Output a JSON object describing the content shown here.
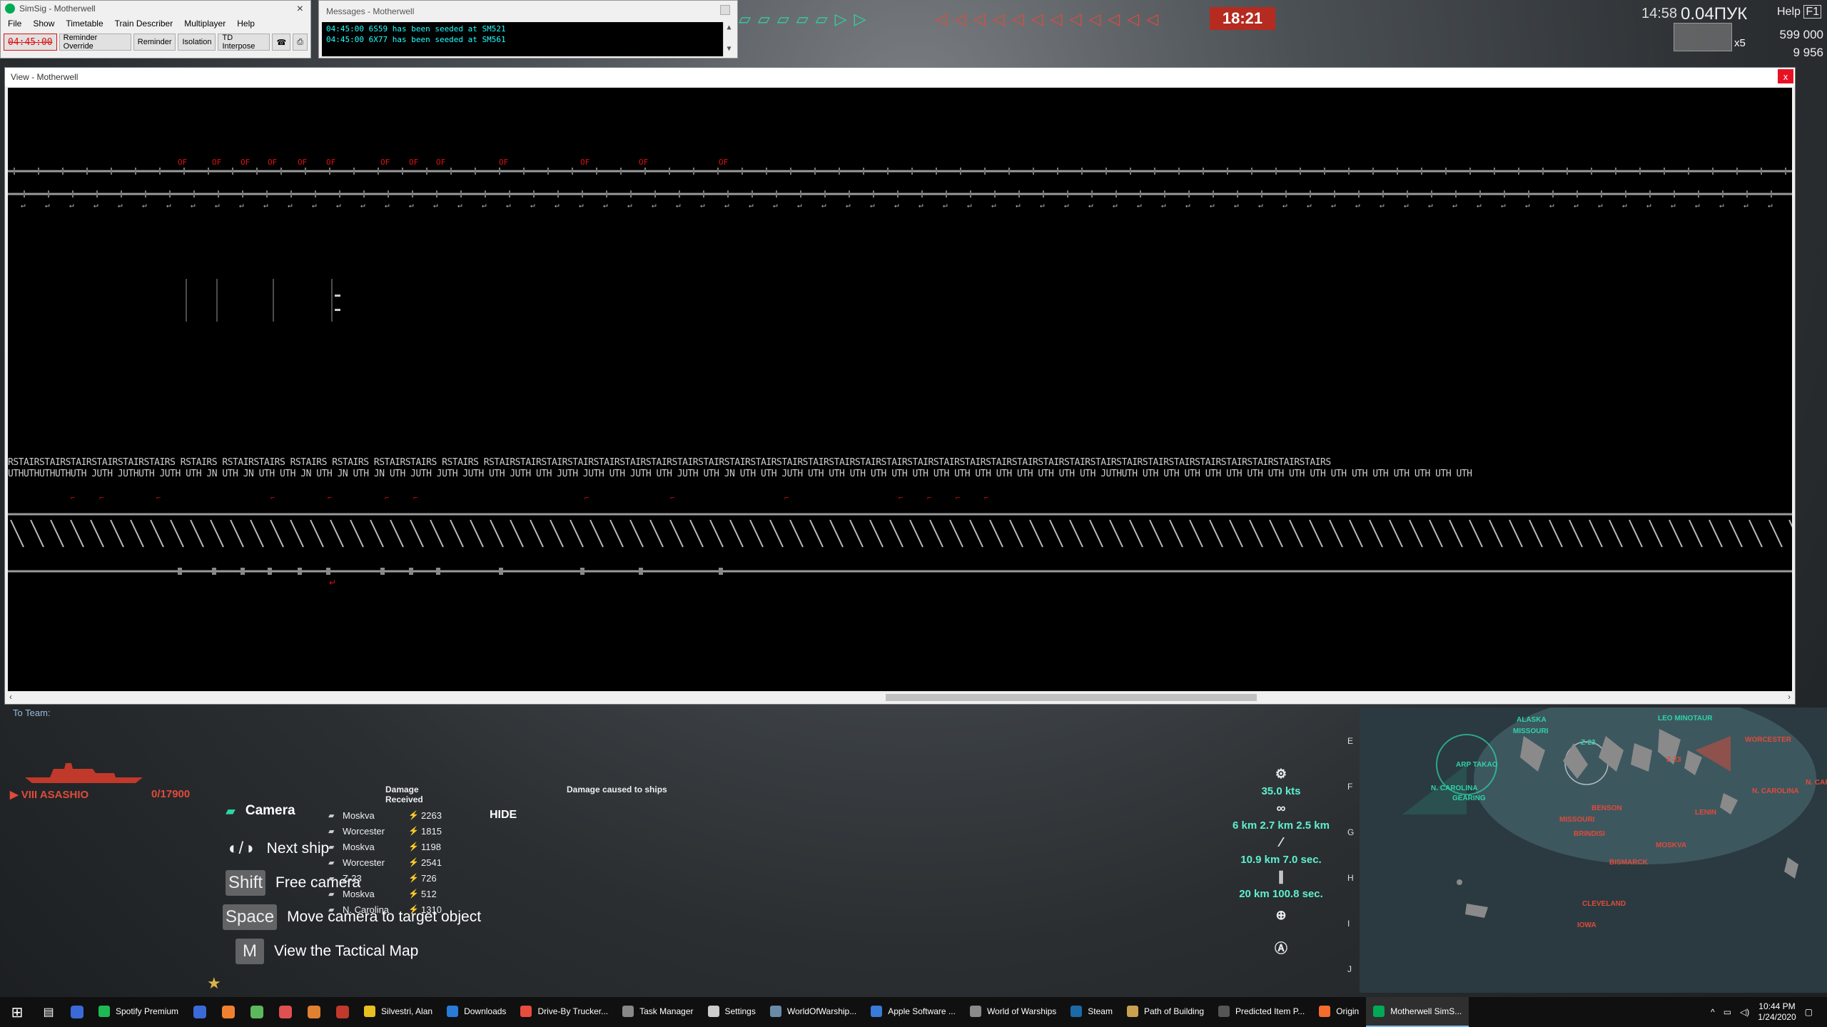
{
  "simsig": {
    "title": "SimSig - Motherwell",
    "menu": [
      "File",
      "Show",
      "Timetable",
      "Train Describer",
      "Multiplayer",
      "Help"
    ],
    "clock": "04:45:00",
    "buttons": [
      "Reminder Override",
      "Reminder",
      "Isolation",
      "TD Interpose"
    ]
  },
  "messages": {
    "title": "Messages - Motherwell",
    "lines": [
      "04:45:00 6S59 has been seeded at SM521",
      "04:45:00 6X77 has been seeded at SM561"
    ]
  },
  "view": {
    "title": "View - Motherwell",
    "close_label": "x",
    "row1_labels": "RSTAIRSTAIRSTAIRSTAIRSTAIRSTAIRS RSTAIRS  RSTAIRSTAIRS  RSTAIRS RSTAIRS   RSTAIRSTAIRS RSTAIRS RSTAIRSTAIRSTAIRSTAIRSTAIRSTAIRSTAIRSTAIRSTAIRSTAIRSTAIRSTAIRSTAIRSTAIRSTAIRSTAIRSTAIRSTAIRSTAIRSTAIRSTAIRSTAIRSTAIRSTAIRSTAIRSTAIRSTAIRSTAIRSTAIRSTAIRSTAIRSTAIRS",
    "row2_labels": "UTHUTHUTHUTHUTH JUTH JUTHUTH JUTH UTH JN  UTH JN  UTH UTH JN  UTH JN UTH JN   UTH JUTH JUTH JUTH UTH JUTH UTH JUTH JUTH UTH JUTH UTH JUTH UTH JN UTH UTH JUTH UTH UTH UTH UTH UTH UTH UTH UTH UTH UTH UTH UTH UTH UTH JUTHUTH UTH UTH UTH UTH UTH UTH UTH UTH UTH UTH UTH UTH UTH UTH UTH UTH"
  },
  "game": {
    "battle_timer": "18:21",
    "clock": "14:58",
    "ping": "0.04ПУК",
    "help": "Help",
    "help_key": "F1",
    "credits": "599 000",
    "free_xp": "9 956",
    "multiplier": "x5",
    "to_team": "To Team:",
    "ship_name": "VIII ASASHIO",
    "ship_hp": "0/17900",
    "camera_title": "Camera",
    "hints": [
      {
        "key": "◐/◑",
        "label": "Next ship"
      },
      {
        "key": "Shift",
        "label": "Free camera"
      },
      {
        "key": "Space",
        "label": "Move camera to target object"
      },
      {
        "key": "M",
        "label": "View the Tactical Map"
      }
    ],
    "damage_received_title": "Damage Received",
    "damage_received": [
      {
        "ship": "Moskva",
        "value": "2263"
      },
      {
        "ship": "Worcester",
        "value": "1815"
      },
      {
        "ship": "Moskva",
        "value": "1198"
      },
      {
        "ship": "Worcester",
        "value": "2541"
      },
      {
        "ship": "Z-23",
        "value": "726"
      },
      {
        "ship": "Moskva",
        "value": "512"
      },
      {
        "ship": "N. Carolina",
        "value": "1310"
      }
    ],
    "hide_label": "HIDE",
    "damage_caused_title": "Damage caused to ships",
    "speed": "35.0 kts",
    "detect": "6 km 2.7 km 2.5 km",
    "torp": "10.9 km 7.0 sec.",
    "guns": "20 km 100.8 sec.",
    "minimap_letters": [
      "E",
      "F",
      "G",
      "H",
      "I",
      "J"
    ],
    "minimap_green": [
      {
        "name": "ALASKA"
      },
      {
        "name": "MISSOURI"
      },
      {
        "name": "LEO MINOTAUR"
      },
      {
        "name": "ARP TAKAO"
      },
      {
        "name": "N. CAROLINA"
      },
      {
        "name": "GEARING"
      },
      {
        "name": "Z-23"
      }
    ],
    "minimap_red": [
      {
        "name": "WORCESTER"
      },
      {
        "name": "N. CAROLINA"
      },
      {
        "name": "BENSON"
      },
      {
        "name": "MISSOURI"
      },
      {
        "name": "BRINDISI"
      },
      {
        "name": "LENIN"
      },
      {
        "name": "MOSKVA"
      },
      {
        "name": "BISMARCK"
      },
      {
        "name": "CLEVELAND"
      },
      {
        "name": "IOWA"
      },
      {
        "name": "Z-23"
      },
      {
        "name": "N. CAROL"
      }
    ]
  },
  "taskbar": {
    "items": [
      {
        "label": "Spotify Premium",
        "color": "#1db954"
      },
      {
        "label": "Silvestri, Alan",
        "color": "#e8c020"
      },
      {
        "label": "Downloads",
        "color": "#2a7ad8"
      },
      {
        "label": "Drive-By Trucker...",
        "color": "#e84c3d"
      },
      {
        "label": "Task Manager",
        "color": "#888888"
      },
      {
        "label": "Settings",
        "color": "#cccccc"
      },
      {
        "label": "WorldOfWarship...",
        "color": "#6a8aa8"
      },
      {
        "label": "Apple Software ...",
        "color": "#3a7ad8"
      },
      {
        "label": "World of Warships",
        "color": "#8a8a8a"
      },
      {
        "label": "Steam",
        "color": "#1b6aa8"
      },
      {
        "label": "Path of Building",
        "color": "#c8a050"
      },
      {
        "label": "Predicted Item P...",
        "color": "#555555"
      },
      {
        "label": "Origin",
        "color": "#f56c2d"
      },
      {
        "label": "Motherwell SimS...",
        "color": "#0a5"
      }
    ],
    "time": "10:44 PM",
    "date": "1/24/2020"
  }
}
